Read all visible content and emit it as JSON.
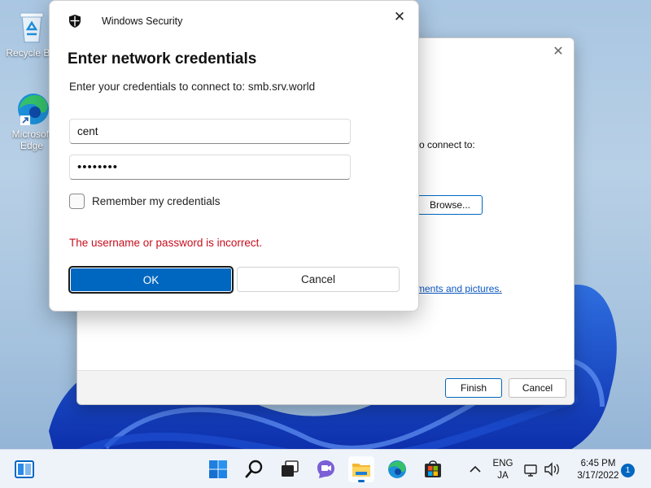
{
  "desktop": {
    "icons": [
      {
        "label": "Recycle Bin"
      },
      {
        "label": "Microsoft Edge"
      }
    ]
  },
  "wizard": {
    "partial_text": "o connect to:",
    "browse_label": "Browse...",
    "link_text": "ments and pictures",
    "link_suffix": ".",
    "finish_label": "Finish",
    "cancel_label": "Cancel"
  },
  "security_dialog": {
    "window_title": "Windows Security",
    "heading": "Enter network credentials",
    "subtitle": "Enter your credentials to connect to: smb.srv.world",
    "username_value": "cent",
    "password_value": "••••••••",
    "remember_label": "Remember my credentials",
    "remember_checked": false,
    "error_text": "The username or password is incorrect.",
    "ok_label": "OK",
    "cancel_label": "Cancel",
    "colors": {
      "accent": "#0067c0",
      "error": "#c50f1f"
    }
  },
  "taskbar": {
    "apps": [
      "start-icon",
      "search-icon",
      "task-view-icon",
      "chat-icon",
      "file-explorer-icon",
      "edge-icon",
      "store-icon"
    ],
    "active_app": "file-explorer-icon",
    "lang_top": "ENG",
    "lang_bottom": "JA",
    "time": "6:45 PM",
    "date": "3/17/2022",
    "notification_count": "1"
  }
}
